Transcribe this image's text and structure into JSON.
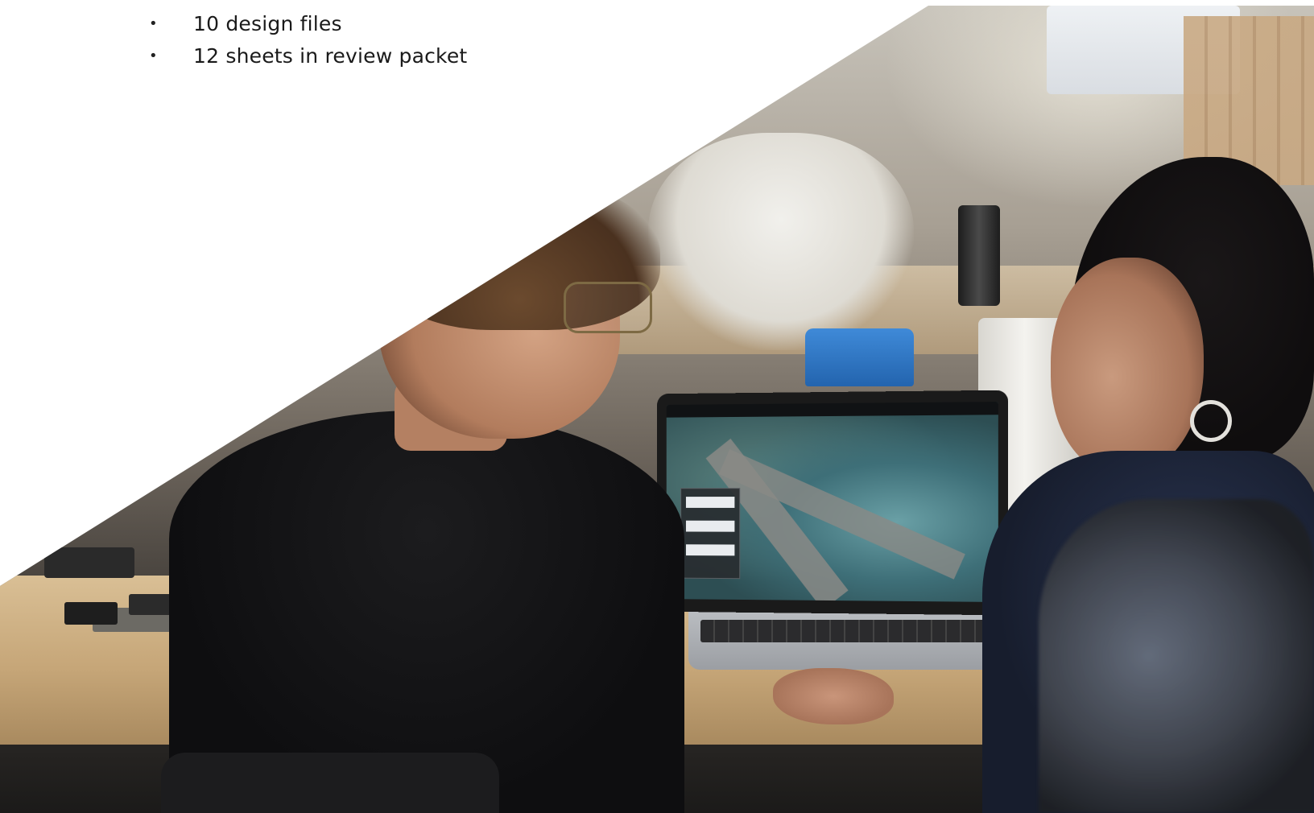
{
  "list": {
    "items": [
      {
        "bullet": "•",
        "text": "10 design files"
      },
      {
        "bullet": "•",
        "text": "12 sheets in review packet"
      }
    ]
  },
  "photo": {
    "colors": {
      "background": "#ffffff",
      "text": "#1a1a1a",
      "shirt": "#0e0e10",
      "blue_box": "#2364ae",
      "desk_wood": "#c6a678"
    }
  }
}
